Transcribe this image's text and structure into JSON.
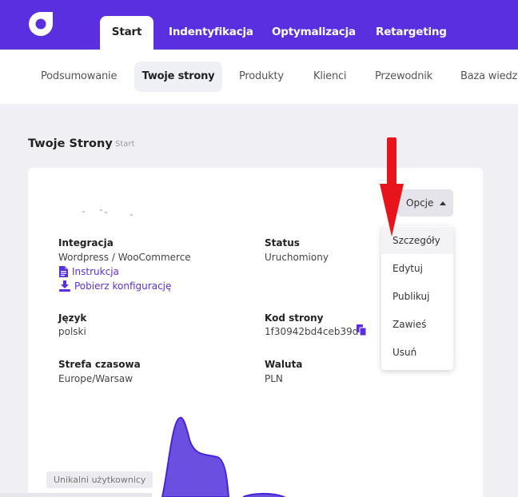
{
  "header": {
    "tabs": [
      {
        "label": "Start",
        "active": true
      },
      {
        "label": "Indentyfikacja"
      },
      {
        "label": "Optymalizacja"
      },
      {
        "label": "Retargeting"
      }
    ],
    "accent": "#5a2fe0"
  },
  "subnav": {
    "items": [
      {
        "label": "Podsumowanie"
      },
      {
        "label": "Twoje strony",
        "active": true
      },
      {
        "label": "Produkty"
      },
      {
        "label": "Klienci"
      },
      {
        "label": "Przewodnik"
      },
      {
        "label": "Baza wiedzy"
      }
    ]
  },
  "page": {
    "title": "Twoje Strony",
    "breadcrumb": "Start"
  },
  "card": {
    "options_label": "Opcje",
    "integration": {
      "label": "Integracja",
      "value": "Wordpress / WooCommerce",
      "instruction_link": "Instrukcja",
      "download_link": "Pobierz konfigurację"
    },
    "status": {
      "label": "Status",
      "value": "Uruchomiony"
    },
    "language": {
      "label": "Język",
      "value": "polski"
    },
    "site_code": {
      "label": "Kod strony",
      "value": "1f30942bd4ceb39d"
    },
    "timezone": {
      "label": "Strefa czasowa",
      "value": "Europe/Warsaw"
    },
    "currency": {
      "label": "Waluta",
      "value": "PLN"
    }
  },
  "dropdown": {
    "items": [
      {
        "label": "Szczegóły",
        "highlighted": true
      },
      {
        "label": "Edytuj"
      },
      {
        "label": "Publikuj"
      },
      {
        "label": "Zawieś"
      },
      {
        "label": "Usuń"
      }
    ]
  },
  "chart": {
    "badge": "Unikalni użytkownicy",
    "fill_color": "#6a4fe0",
    "stroke_color": "#4a24d6"
  },
  "annotation": {
    "arrow_color": "#e8141c"
  }
}
